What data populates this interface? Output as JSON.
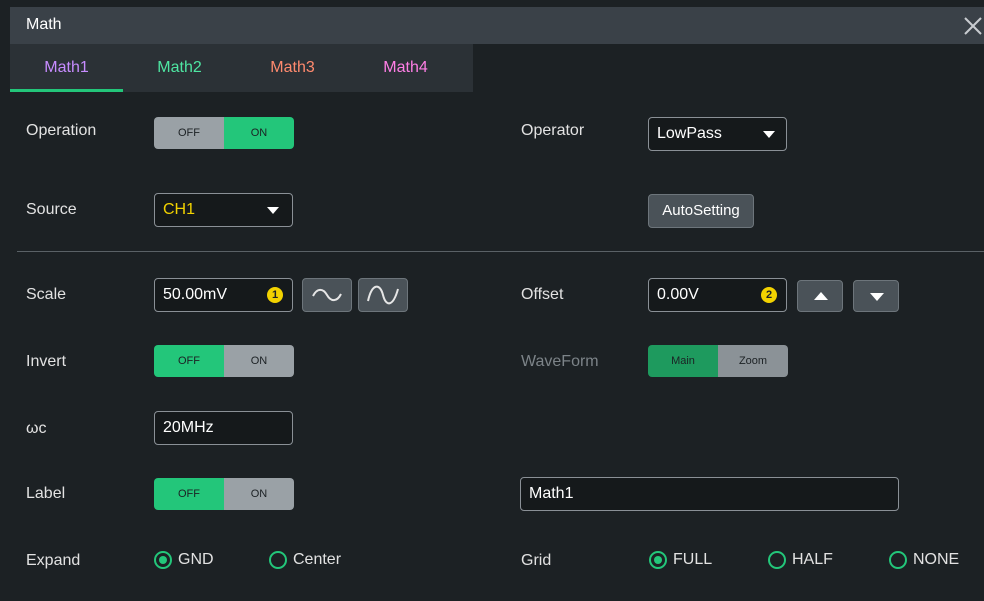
{
  "window": {
    "title": "Math"
  },
  "tabs": [
    {
      "label": "Math1",
      "color": "#c78cff",
      "active": true
    },
    {
      "label": "Math2",
      "color": "#4ee6a2"
    },
    {
      "label": "Math3",
      "color": "#ff8a6e"
    },
    {
      "label": "Math4",
      "color": "#ff7fe6"
    }
  ],
  "operation": {
    "label": "Operation",
    "off": "OFF",
    "on": "ON",
    "selected": "ON"
  },
  "operator": {
    "label": "Operator",
    "value": "LowPass"
  },
  "source": {
    "label": "Source",
    "value": "CH1"
  },
  "autosetting": {
    "label": "AutoSetting"
  },
  "scale": {
    "label": "Scale",
    "value": "50.00mV",
    "knob": "1"
  },
  "offset": {
    "label": "Offset",
    "value": "0.00V",
    "knob": "2"
  },
  "invert": {
    "label": "Invert",
    "off": "OFF",
    "on": "ON",
    "selected": "OFF"
  },
  "waveform": {
    "label": "WaveForm",
    "main": "Main",
    "zoom": "Zoom",
    "selected": "Main"
  },
  "wc": {
    "label": "ωc",
    "value": "20MHz"
  },
  "label_row": {
    "label": "Label",
    "off": "OFF",
    "on": "ON",
    "selected": "OFF",
    "text": "Math1"
  },
  "expand": {
    "label": "Expand",
    "options": [
      "GND",
      "Center"
    ],
    "selected": "GND"
  },
  "grid": {
    "label": "Grid",
    "options": [
      "FULL",
      "HALF",
      "NONE"
    ],
    "selected": "FULL"
  },
  "colors": {
    "accent": "#23c67a",
    "source_value": "#f2d200",
    "knob": "#f2d200"
  }
}
